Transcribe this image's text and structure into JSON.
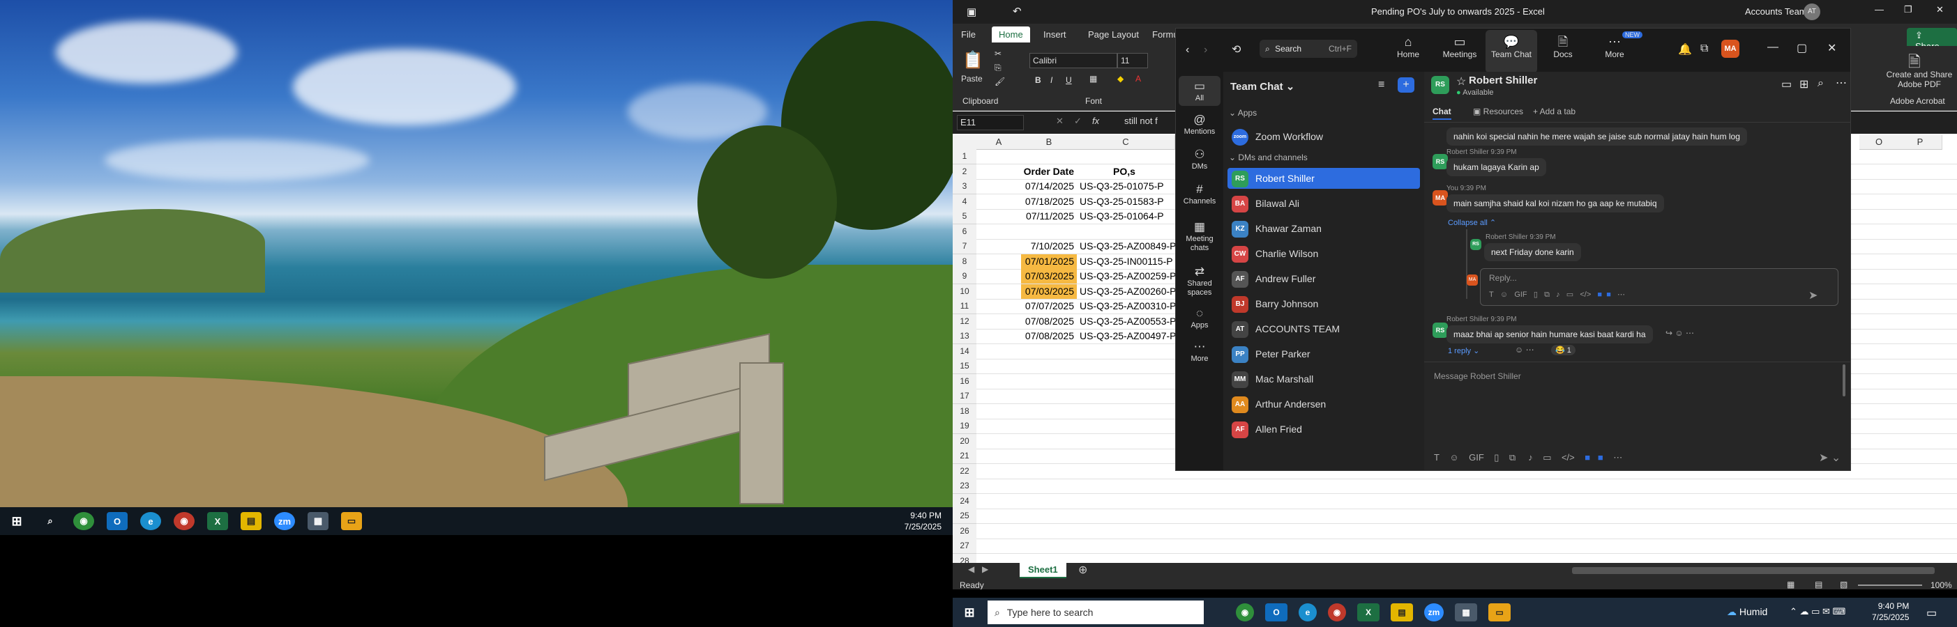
{
  "left_taskbar": {
    "time": "9:40 PM",
    "date": "7/25/2025",
    "apps": [
      "start-icon",
      "search-icon",
      "chrome-icon",
      "outlook-icon",
      "edge-icon",
      "chrome-icon",
      "excel-icon",
      "sticky-icon",
      "zoom-icon",
      "calculator-icon",
      "explorer-icon"
    ]
  },
  "excel": {
    "title": "Pending PO's July to onwards 2025  -  Excel",
    "account": "Accounts Team",
    "account_initials": "AT",
    "tabs": [
      "File",
      "Home",
      "Insert",
      "Page Layout",
      "Formul"
    ],
    "share_label": "Share",
    "font_name": "Calibri",
    "font_size": "11",
    "groups": {
      "clipboard": "Clipboard",
      "font": "Font",
      "adobe": "Adobe Acrobat"
    },
    "create_pdf": "Create and Share Adobe PDF",
    "paste": "Paste",
    "name_box": "E11",
    "formula_fx": "fx",
    "formula_value": "still not f",
    "columns": [
      "A",
      "B",
      "C",
      "O",
      "P"
    ],
    "rows": [
      "1",
      "2",
      "3",
      "4",
      "5",
      "6",
      "7",
      "8",
      "9",
      "10",
      "11",
      "12",
      "13",
      "14",
      "15",
      "16",
      "17",
      "18",
      "19",
      "20",
      "21",
      "22",
      "23",
      "24",
      "25",
      "26",
      "27",
      "28"
    ],
    "header_row": {
      "b": "Order Date",
      "c": "PO,s"
    },
    "data": [
      {
        "row": "3",
        "b": "07/14/2025",
        "c": "US-Q3-25-01075-P",
        "hl": false
      },
      {
        "row": "4",
        "b": "07/18/2025",
        "c": "US-Q3-25-01583-P",
        "hl": false
      },
      {
        "row": "5",
        "b": "07/11/2025",
        "c": "US-Q3-25-01064-P",
        "hl": false
      },
      {
        "row": "7",
        "b": "7/10/2025",
        "c": "US-Q3-25-AZ00849-P",
        "hl": false
      },
      {
        "row": "8",
        "b": "07/01/2025",
        "c": "US-Q3-25-IN00115-P",
        "hl": true
      },
      {
        "row": "9",
        "b": "07/03/2025",
        "c": "US-Q3-25-AZ00259-P",
        "hl": true
      },
      {
        "row": "10",
        "b": "07/03/2025",
        "c": "US-Q3-25-AZ00260-P",
        "hl": true
      },
      {
        "row": "11",
        "b": "07/07/2025",
        "c": "US-Q3-25-AZ00310-P",
        "hl": false
      },
      {
        "row": "12",
        "b": "07/08/2025",
        "c": "US-Q3-25-AZ00553-P",
        "hl": false
      },
      {
        "row": "13",
        "b": "07/08/2025",
        "c": "US-Q3-25-AZ00497-P",
        "hl": false
      }
    ],
    "sheet_tab": "Sheet1",
    "status_ready": "Ready",
    "zoom_level": "100%"
  },
  "right_taskbar": {
    "search_placeholder": "Type here to search",
    "weather": "Humid",
    "time": "9:40 PM",
    "date": "7/25/2025"
  },
  "zoom": {
    "nav": [
      {
        "label": "Home",
        "icon": "home-icon"
      },
      {
        "label": "Meetings",
        "icon": "camera-icon"
      },
      {
        "label": "Team Chat",
        "icon": "chat-icon"
      },
      {
        "label": "Docs",
        "icon": "doc-icon"
      },
      {
        "label": "More",
        "icon": "more-icon"
      }
    ],
    "new_badge": "NEW",
    "search_label": "Search",
    "search_shortcut": "Ctrl+F",
    "user_initials": "MA",
    "rail": [
      {
        "label": "All",
        "icon": "chat-icon"
      },
      {
        "label": "Mentions",
        "icon": "at-icon"
      },
      {
        "label": "DMs",
        "icon": "people-icon"
      },
      {
        "label": "Channels",
        "icon": "hash-icon"
      },
      {
        "label": "Meeting chats",
        "icon": "calendar-icon"
      },
      {
        "label": "Shared spaces",
        "icon": "share-icon"
      },
      {
        "label": "Apps",
        "icon": "apps-icon"
      },
      {
        "label": "More",
        "icon": "more-icon"
      }
    ],
    "panel_title": "Team Chat",
    "section_apps": "Apps",
    "zoom_workflow": "Zoom Workflow",
    "section_dms": "DMs and channels",
    "contacts": [
      {
        "name": "Robert Shiller",
        "initials": "RS",
        "color": "#2e9d5a",
        "selected": true
      },
      {
        "name": "Bilawal Ali",
        "initials": "BA",
        "color": "#d64545",
        "selected": false
      },
      {
        "name": "Khawar Zaman",
        "initials": "KZ",
        "color": "#3b82c4",
        "selected": false
      },
      {
        "name": "Charlie Wilson",
        "initials": "CW",
        "color": "#d64545",
        "selected": false
      },
      {
        "name": "Andrew Fuller",
        "initials": "AF",
        "color": "#555",
        "selected": false
      },
      {
        "name": "Barry Johnson",
        "initials": "BJ",
        "color": "#c0392b",
        "selected": false
      },
      {
        "name": "ACCOUNTS TEAM",
        "initials": "AT",
        "color": "#444",
        "selected": false
      },
      {
        "name": "Peter Parker",
        "initials": "PP",
        "color": "#3b82c4",
        "selected": false
      },
      {
        "name": "Mac Marshall",
        "initials": "MM",
        "color": "#444",
        "selected": false
      },
      {
        "name": "Arthur Andersen",
        "initials": "AA",
        "color": "#e08a1e",
        "selected": false
      },
      {
        "name": "Allen Fried",
        "initials": "AF",
        "color": "#d64545",
        "selected": false
      }
    ],
    "chat_header": {
      "name": "Robert Shiller",
      "status": "Available",
      "initials": "RS",
      "tab_chat": "Chat",
      "tab_resources": "Resources",
      "tab_add": "+ Add a tab"
    },
    "messages": [
      {
        "meta": "",
        "text": "nahin koi special nahin he mere wajah se  jaise sub normal jatay hain hum log",
        "initials": ""
      },
      {
        "meta": "Robert Shiller 9:39 PM",
        "text": "hukam lagaya Karin ap",
        "initials": "RS"
      },
      {
        "meta": "You 9:39 PM",
        "text": "main samjha shaid kal koi nizam ho ga aap ke mutabiq",
        "initials": "MA"
      }
    ],
    "collapse_all": "Collapse all",
    "thread_reply": {
      "meta": "Robert Shiller 9:39 PM",
      "text": "next Friday done karin",
      "initials": "RS"
    },
    "reply_placeholder": "Reply...",
    "last_msg": {
      "meta": "Robert Shiller 9:39 PM",
      "text": "maaz bhai ap senior hain humare kasi baat kardi ha",
      "initials": "RS"
    },
    "reply_count": "1 reply",
    "reaction_count": "1",
    "message_placeholder": "Message Robert Shiller",
    "gif_label": "GIF"
  }
}
